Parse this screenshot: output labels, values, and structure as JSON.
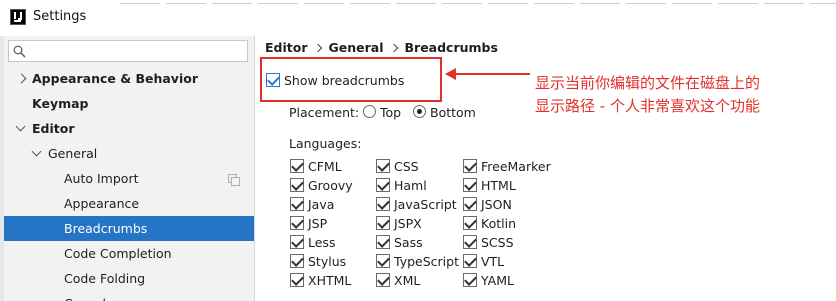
{
  "window": {
    "title": "Settings"
  },
  "sidebar": {
    "search_placeholder": "",
    "items": [
      {
        "label": "Appearance & Behavior"
      },
      {
        "label": "Keymap"
      },
      {
        "label": "Editor"
      },
      {
        "label": "General"
      },
      {
        "label": "Auto Import"
      },
      {
        "label": "Appearance"
      },
      {
        "label": "Breadcrumbs"
      },
      {
        "label": "Code Completion"
      },
      {
        "label": "Code Folding"
      },
      {
        "label": "Console"
      }
    ]
  },
  "breadcrumb": [
    "Editor",
    "General",
    "Breadcrumbs"
  ],
  "show_breadcrumbs": {
    "label": "Show breadcrumbs",
    "checked": true
  },
  "placement": {
    "label": "Placement:",
    "options": [
      {
        "label": "Top",
        "selected": false
      },
      {
        "label": "Bottom",
        "selected": true
      }
    ]
  },
  "languages": {
    "label": "Languages:",
    "items": [
      "CFML",
      "CSS",
      "FreeMarker",
      "Groovy",
      "Haml",
      "HTML",
      "Java",
      "JavaScript",
      "JSON",
      "JSP",
      "JSPX",
      "Kotlin",
      "Less",
      "Sass",
      "SCSS",
      "Stylus",
      "TypeScript",
      "VTL",
      "XHTML",
      "XML",
      "YAML"
    ]
  },
  "annotation": {
    "line1": "显示当前你编辑的文件在磁盘上的",
    "line2": "显示路径 - 个人非常喜欢这个功能"
  },
  "colors": {
    "accent": "#2574c5",
    "annotation": "#e2302d"
  }
}
